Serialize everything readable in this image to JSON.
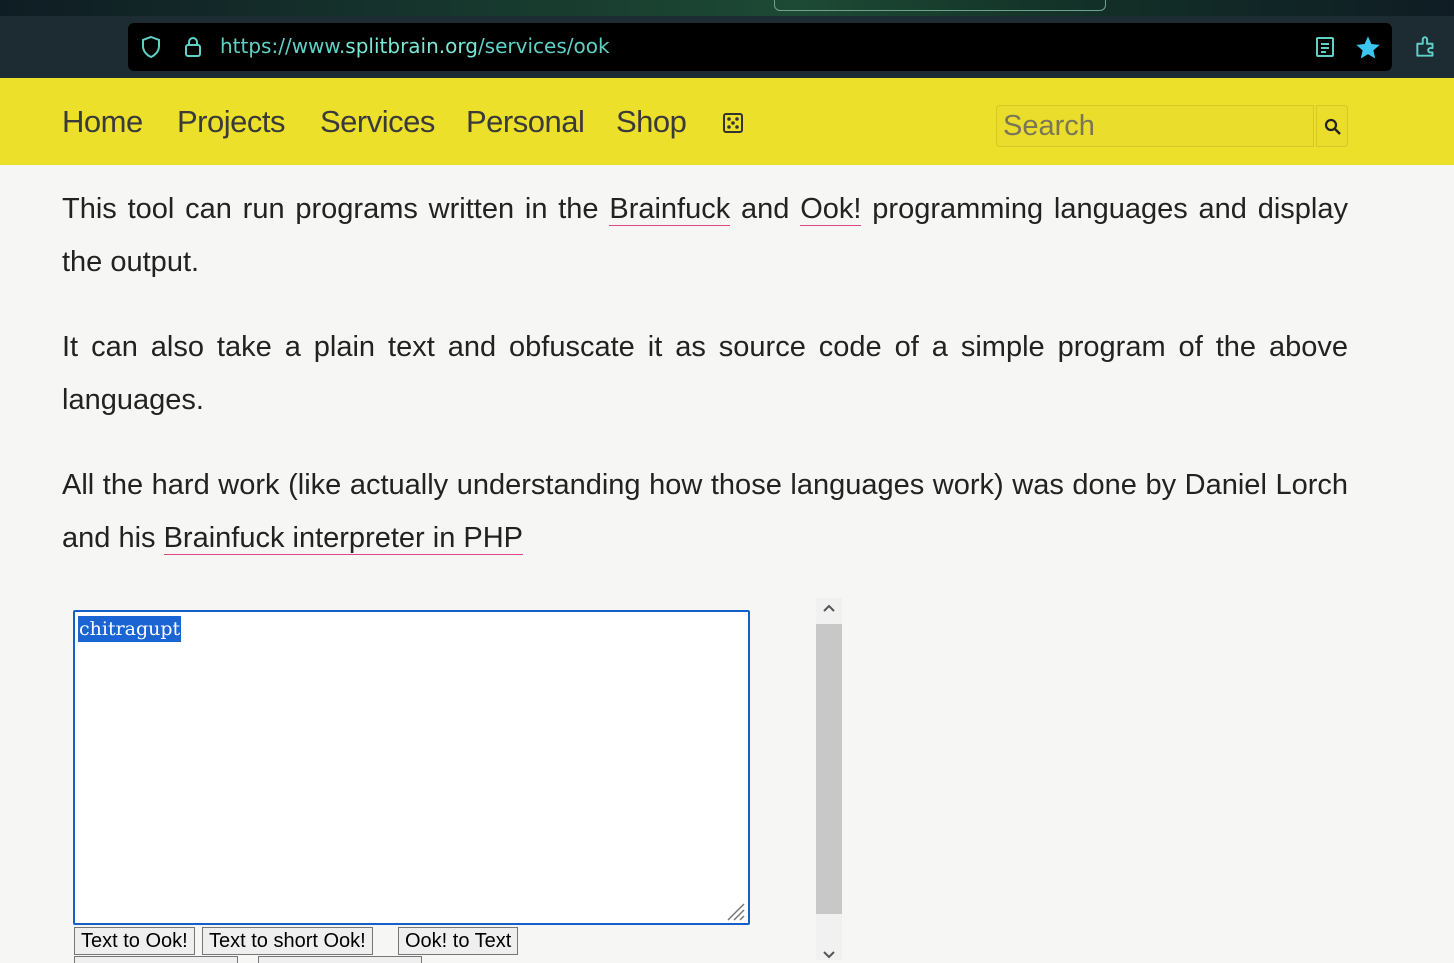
{
  "browser": {
    "url_prefix": "https://www.",
    "url_domain": "splitbrain.org",
    "url_path": "/services/ook",
    "icons": [
      "shield-icon",
      "lock-icon",
      "reader-view-icon",
      "bookmark-star-icon",
      "extensions-icon"
    ],
    "accent": "#5fd1c6"
  },
  "nav": {
    "items": [
      "Home",
      "Projects",
      "Services",
      "Personal",
      "Shop"
    ],
    "random_icon": "dice-icon",
    "search_placeholder": "Search",
    "background": "#ede02a"
  },
  "content": {
    "p1": {
      "before": "This tool can run programs written in the ",
      "link1": "Brainfuck",
      "mid": " and ",
      "link2": "Ook!",
      "after": " programming languages and display the output."
    },
    "p2": "It can also take a plain text and obfuscate it as source code of a simple program of the above languages.",
    "p3": {
      "before": "All the hard work (like actually understanding how those languages work) was done by Daniel Lorch and his ",
      "link": "Brainfuck interpreter in PHP"
    }
  },
  "tool": {
    "input_value": "chitragupt",
    "buttons": [
      "Text to Ook!",
      "Text to short Ook!",
      "Ook! to Text"
    ]
  }
}
